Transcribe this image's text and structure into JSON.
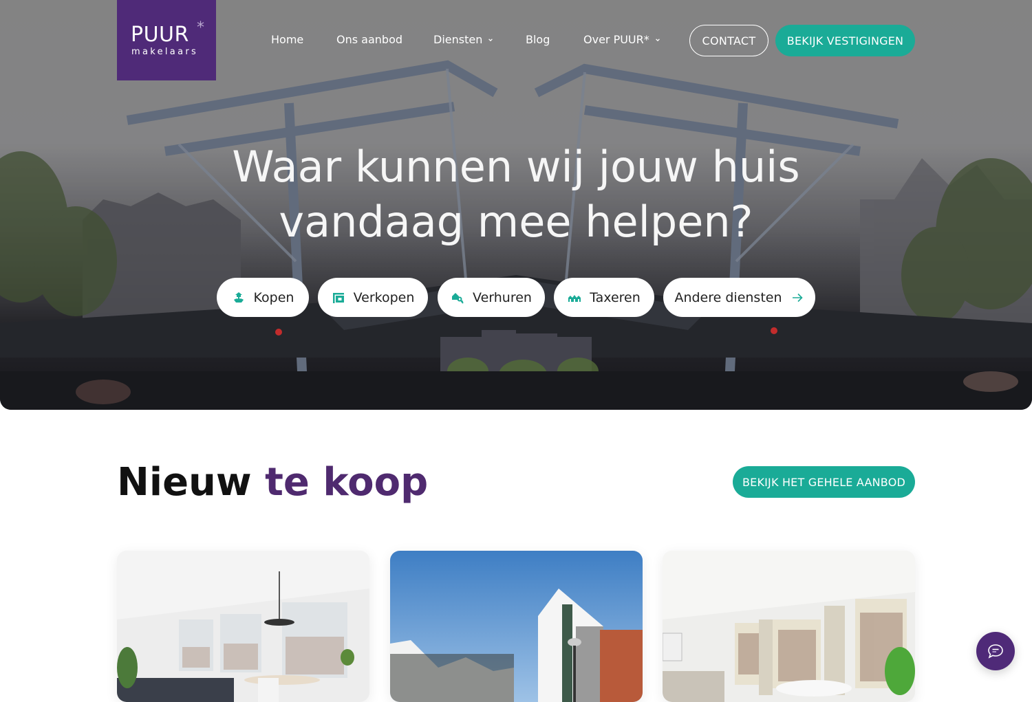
{
  "brand": {
    "name": "PUUR",
    "star": "*",
    "subtitle": "makelaars",
    "colors": {
      "purple": "#4f2a78",
      "teal": "#1aab97",
      "heading_accent": "#4f2a6f"
    }
  },
  "nav": {
    "items": [
      {
        "label": "Home",
        "has_dropdown": false
      },
      {
        "label": "Ons aanbod",
        "has_dropdown": false
      },
      {
        "label": "Diensten",
        "has_dropdown": true
      },
      {
        "label": "Blog",
        "has_dropdown": false
      },
      {
        "label": "Over PUUR*",
        "has_dropdown": true
      }
    ],
    "contact_label": "CONTACT",
    "vestigingen_label": "BEKIJK VESTIGINGEN"
  },
  "hero": {
    "title_line1": "Waar kunnen wij jouw huis",
    "title_line2": "vandaag mee helpen?",
    "chips": [
      {
        "label": "Kopen",
        "icon": "house-hand-icon"
      },
      {
        "label": "Verkopen",
        "icon": "for-sale-sign-icon"
      },
      {
        "label": "Verhuren",
        "icon": "house-key-icon"
      },
      {
        "label": "Taxeren",
        "icon": "houses-row-icon"
      },
      {
        "label": "Andere diensten",
        "icon": "arrow-right-icon"
      }
    ]
  },
  "listings": {
    "title_part1": "Nieuw",
    "title_part2": "te koop",
    "view_all_label": "BEKIJK HET GEHELE AANBOD",
    "cards": [
      {
        "image": "living-room-with-dining-table-photo"
      },
      {
        "image": "modern-apartment-building-exterior-photo"
      },
      {
        "image": "bright-living-room-with-tall-windows-photo"
      }
    ]
  },
  "chat": {
    "icon": "chat-bubble-icon"
  }
}
